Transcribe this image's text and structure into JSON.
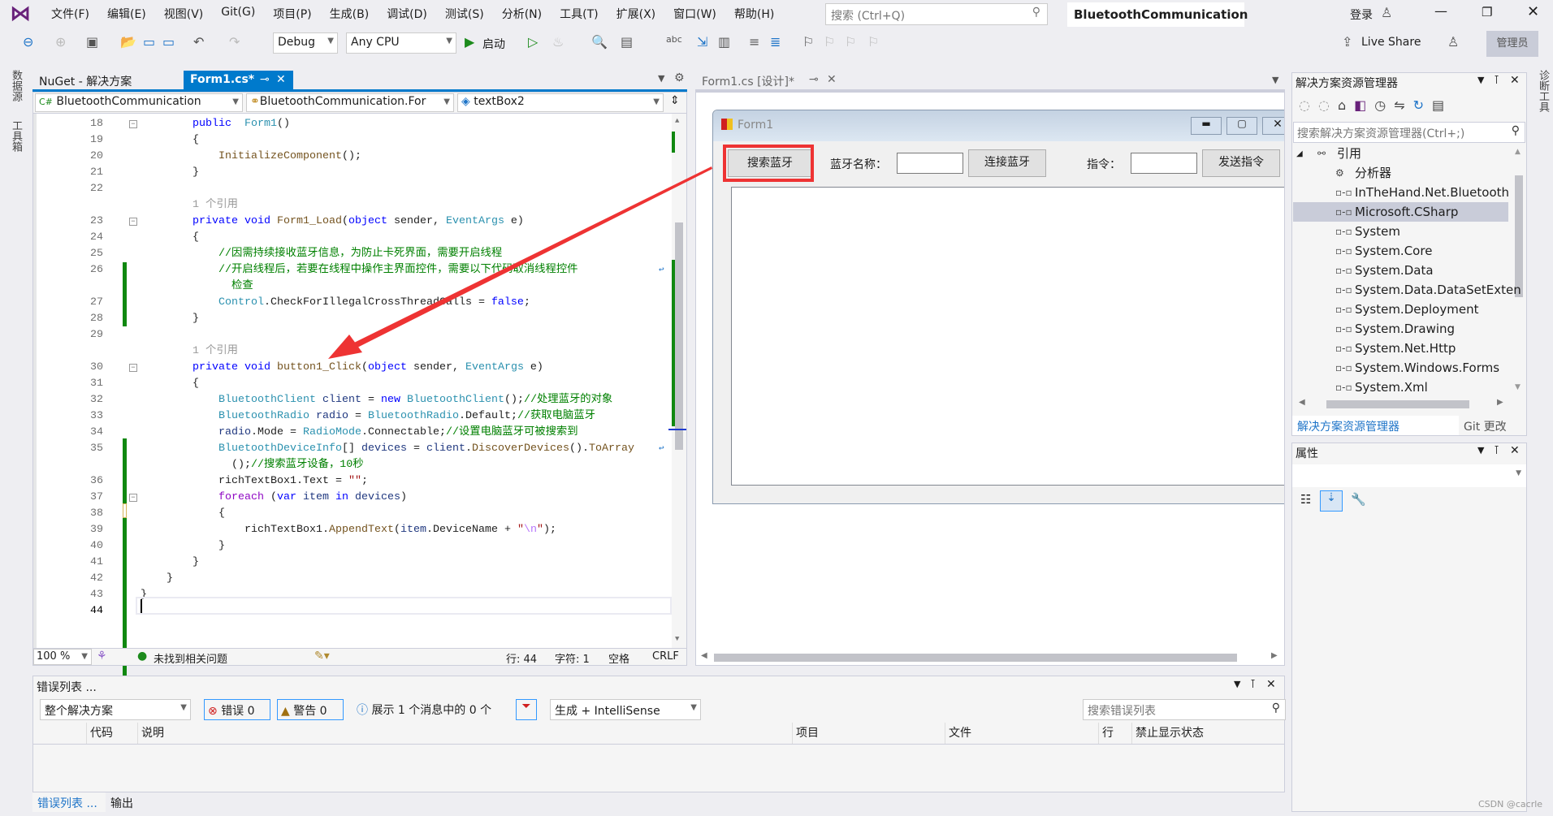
{
  "menu": {
    "items": [
      "文件(F)",
      "编辑(E)",
      "视图(V)",
      "Git(G)",
      "项目(P)",
      "生成(B)",
      "调试(D)",
      "测试(S)",
      "分析(N)",
      "工具(T)",
      "扩展(X)",
      "窗口(W)",
      "帮助(H)"
    ],
    "search_placeholder": "搜索 (Ctrl+Q)",
    "solution_title": "BluetoothCommunication",
    "login": "登录"
  },
  "toolbar": {
    "config": "Debug",
    "platform": "Any CPU",
    "start": "启动",
    "live_share": "Live Share",
    "admin": "管理员"
  },
  "side_left": [
    "数据源",
    "工具箱"
  ],
  "side_right": [
    "诊断工具"
  ],
  "editor": {
    "tabs": [
      {
        "label": "NuGet - 解决方案",
        "active": false
      },
      {
        "label": "Form1.cs*",
        "active": true
      }
    ],
    "nav": {
      "project": "BluetoothCommunication",
      "class": "BluetoothCommunication.For",
      "member": "textBox2"
    },
    "lines": [
      {
        "n": "18",
        "i": 8,
        "t": [
          [
            "kw",
            "public"
          ],
          [
            "",
            "  "
          ],
          [
            "ty",
            "Form1"
          ],
          [
            "",
            "()"
          ]
        ]
      },
      {
        "n": "19",
        "i": 8,
        "t": [
          [
            "",
            "{"
          ]
        ]
      },
      {
        "n": "20",
        "i": 12,
        "t": [
          [
            "me",
            "InitializeComponent"
          ],
          [
            "",
            "();"
          ]
        ]
      },
      {
        "n": "21",
        "i": 8,
        "t": [
          [
            "",
            "}"
          ]
        ]
      },
      {
        "n": "22",
        "i": 0,
        "t": []
      },
      {
        "n": "",
        "i": 8,
        "t": [
          [
            "gr",
            "1 个引用"
          ]
        ]
      },
      {
        "n": "23",
        "i": 8,
        "t": [
          [
            "kw",
            "private void "
          ],
          [
            "me",
            "Form1_Load"
          ],
          [
            "",
            "("
          ],
          [
            "kw",
            "object"
          ],
          [
            "",
            " sender, "
          ],
          [
            "ty",
            "EventArgs"
          ],
          [
            "",
            " e)"
          ]
        ]
      },
      {
        "n": "24",
        "i": 8,
        "t": [
          [
            "",
            "{"
          ]
        ]
      },
      {
        "n": "25",
        "i": 12,
        "t": [
          [
            "cm",
            "//因需持续接收蓝牙信息，为防止卡死界面，需要开启线程"
          ]
        ]
      },
      {
        "n": "26",
        "i": 12,
        "t": [
          [
            "cm",
            "//开启线程后，若要在线程中操作主界面控件，需要以下代码取消线程控件"
          ]
        ],
        "wrap": true
      },
      {
        "n": "",
        "i": 14,
        "t": [
          [
            "cm",
            "检查"
          ]
        ]
      },
      {
        "n": "27",
        "i": 12,
        "t": [
          [
            "ty",
            "Control"
          ],
          [
            "",
            ".CheckForIllegalCrossThreadCalls = "
          ],
          [
            "kw",
            "false"
          ],
          [
            "",
            ";"
          ]
        ]
      },
      {
        "n": "28",
        "i": 8,
        "t": [
          [
            "",
            "}"
          ]
        ]
      },
      {
        "n": "29",
        "i": 0,
        "t": []
      },
      {
        "n": "",
        "i": 8,
        "t": [
          [
            "gr",
            "1 个引用"
          ]
        ]
      },
      {
        "n": "30",
        "i": 8,
        "t": [
          [
            "kw",
            "private void "
          ],
          [
            "me",
            "button1_Click"
          ],
          [
            "",
            "("
          ],
          [
            "kw",
            "object"
          ],
          [
            "",
            " sender, "
          ],
          [
            "ty",
            "EventArgs"
          ],
          [
            "",
            " e)"
          ]
        ]
      },
      {
        "n": "31",
        "i": 8,
        "t": [
          [
            "",
            "{"
          ]
        ]
      },
      {
        "n": "32",
        "i": 12,
        "t": [
          [
            "ty",
            "BluetoothClient"
          ],
          [
            "",
            " "
          ],
          [
            "va",
            "client"
          ],
          [
            "",
            " = "
          ],
          [
            "kw",
            "new"
          ],
          [
            "",
            " "
          ],
          [
            "ty",
            "BluetoothClient"
          ],
          [
            "",
            "();"
          ],
          [
            "cm",
            "//处理蓝牙的对象"
          ]
        ]
      },
      {
        "n": "33",
        "i": 12,
        "t": [
          [
            "ty",
            "BluetoothRadio"
          ],
          [
            "",
            " "
          ],
          [
            "va",
            "radio"
          ],
          [
            "",
            " = "
          ],
          [
            "ty",
            "BluetoothRadio"
          ],
          [
            "",
            ".Default;"
          ],
          [
            "cm",
            "//获取电脑蓝牙"
          ]
        ]
      },
      {
        "n": "34",
        "i": 12,
        "t": [
          [
            "va",
            "radio"
          ],
          [
            "",
            ".Mode = "
          ],
          [
            "ty",
            "RadioMode"
          ],
          [
            "",
            ".Connectable;"
          ],
          [
            "cm",
            "//设置电脑蓝牙可被搜索到"
          ]
        ]
      },
      {
        "n": "35",
        "i": 12,
        "t": [
          [
            "ty",
            "BluetoothDeviceInfo"
          ],
          [
            "",
            "[] "
          ],
          [
            "va",
            "devices"
          ],
          [
            "",
            " = "
          ],
          [
            "va",
            "client"
          ],
          [
            "",
            "."
          ],
          [
            "me",
            "DiscoverDevices"
          ],
          [
            "",
            "()."
          ],
          [
            "me",
            "ToArray"
          ]
        ],
        "wrap": true
      },
      {
        "n": "",
        "i": 14,
        "t": [
          [
            "",
            "();"
          ],
          [
            "cm",
            "//搜索蓝牙设备，10秒"
          ]
        ]
      },
      {
        "n": "36",
        "i": 12,
        "t": [
          [
            "",
            "richTextBox1.Text = "
          ],
          [
            "st",
            "\"\""
          ],
          [
            "",
            ";"
          ]
        ]
      },
      {
        "n": "37",
        "i": 12,
        "t": [
          [
            "ct",
            "foreach"
          ],
          [
            "",
            " ("
          ],
          [
            "kw",
            "var"
          ],
          [
            "",
            " "
          ],
          [
            "va",
            "item"
          ],
          [
            "",
            " "
          ],
          [
            "kw",
            "in"
          ],
          [
            "",
            " "
          ],
          [
            "va",
            "devices"
          ],
          [
            "",
            ")"
          ]
        ]
      },
      {
        "n": "38",
        "i": 12,
        "t": [
          [
            "",
            "{"
          ]
        ]
      },
      {
        "n": "39",
        "i": 16,
        "t": [
          [
            "",
            "richTextBox1."
          ],
          [
            "me",
            "AppendText"
          ],
          [
            "",
            "("
          ],
          [
            "va",
            "item"
          ],
          [
            "",
            ".DeviceName + "
          ],
          [
            "st",
            "\""
          ],
          [
            "es",
            "\\n"
          ],
          [
            "st",
            "\""
          ],
          [
            "",
            ");"
          ]
        ]
      },
      {
        "n": "40",
        "i": 12,
        "t": [
          [
            "",
            "}"
          ]
        ]
      },
      {
        "n": "41",
        "i": 8,
        "t": [
          [
            "",
            "}"
          ]
        ]
      },
      {
        "n": "42",
        "i": 4,
        "t": [
          [
            "",
            "}"
          ]
        ]
      },
      {
        "n": "43",
        "i": 0,
        "t": [
          [
            "",
            "}"
          ]
        ]
      },
      {
        "n": "44",
        "i": 0,
        "t": []
      }
    ],
    "status": {
      "zoom": "100 %",
      "issues": "未找到相关问题",
      "line": "行: 44",
      "char": "字符: 1",
      "spaces": "空格",
      "eol": "CRLF"
    }
  },
  "designer": {
    "tab": "Form1.cs [设计]*",
    "form_title": "Form1",
    "search_button": "搜索蓝牙",
    "name_label": "蓝牙名称：",
    "connect_button": "连接蓝牙",
    "cmd_label": "指令：",
    "send_button": "发送指令",
    "annotation_color": "#ee3333"
  },
  "solution": {
    "title": "解决方案资源管理器",
    "search_placeholder": "搜索解决方案资源管理器(Ctrl+;)",
    "references": "引用",
    "analyzers": "分析器",
    "items": [
      "InTheHand.Net.Bluetooth",
      "Microsoft.CSharp",
      "System",
      "System.Core",
      "System.Data",
      "System.Data.DataSetExten",
      "System.Deployment",
      "System.Drawing",
      "System.Net.Http",
      "System.Windows.Forms",
      "System.Xml"
    ],
    "selected": "Microsoft.CSharp",
    "tabs": [
      "解决方案资源管理器",
      "Git 更改"
    ]
  },
  "properties": {
    "title": "属性"
  },
  "errors": {
    "title": "错误列表 ...",
    "scope": "整个解决方案",
    "errors": "错误 0",
    "warnings": "警告 0",
    "messages": "展示 1 个消息中的 0 个",
    "source": "生成 + IntelliSense",
    "search_placeholder": "搜索错误列表",
    "columns": [
      "代码",
      "说明",
      "项目",
      "文件",
      "行",
      "禁止显示状态"
    ],
    "bottom_tabs": [
      "错误列表 ...",
      "输出"
    ]
  },
  "watermark": "CSDN @cacrle"
}
